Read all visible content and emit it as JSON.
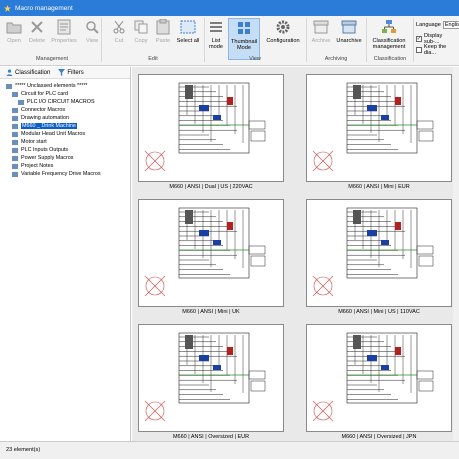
{
  "window": {
    "title": "Macro management"
  },
  "toolbar": {
    "management": {
      "label": "Management",
      "buttons": [
        "Open",
        "Delete",
        "Properties"
      ]
    },
    "edit": {
      "label": "Edit",
      "buttons": [
        "View",
        "Cut",
        "Copy",
        "Paste",
        "Select all"
      ]
    },
    "view": {
      "label": "View",
      "buttons": [
        "List mode",
        "Thumbnail Mode",
        "Configuration"
      ]
    },
    "archiving": {
      "label": "Archiving",
      "buttons": [
        "Archive",
        "Unarchive"
      ]
    },
    "classification": {
      "label": "Classification",
      "buttons": [
        "Classification management"
      ]
    },
    "language": {
      "label": "Language",
      "value": "English"
    },
    "display_sub": "Display sub-...",
    "keep_dia": "Keep the dia..."
  },
  "left": {
    "tabs": [
      "Classification",
      "Filters"
    ],
    "tree": [
      "***** Unclassed elements *****",
      "Circuit for PLC card",
      "PLC I/O CIRCUIT MACROS",
      "Connector Macros",
      "Drawing automation",
      "M660 _ Drink Machine",
      "Modular Head Unit Macros",
      "Motor start",
      "PLC Inputs Outputs",
      "Power Supply Macros",
      "Project Notes",
      "Variable Frequency Drive Macros"
    ]
  },
  "thumbnails": [
    "M660 | ANSI | Dual | US | 220VAC",
    "M660 | ANSI | Mini | EUR",
    "M660 | ANSI | Mini | UK",
    "M660 | ANSI | Mini | US | 110VAC",
    "M660 | ANSI | Oversized | EUR",
    "M660 | ANSI | Oversized | JPN"
  ],
  "status": {
    "text": "23 element(s)"
  }
}
